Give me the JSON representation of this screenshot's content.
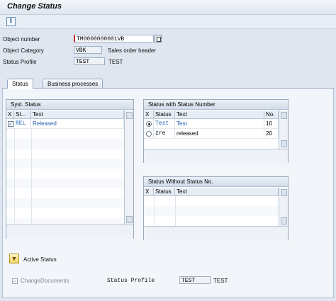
{
  "window": {
    "title": "Change Status"
  },
  "toolbar": {
    "info_icon": "info-icon"
  },
  "header_fields": {
    "object_number": {
      "label": "Object number",
      "value": "TM0000000001VB"
    },
    "object_category": {
      "label": "Object Category",
      "value": "VBK",
      "description": "Sales order header"
    },
    "status_profile": {
      "label": "Status Profile",
      "value": "TEST",
      "description": "TEST"
    }
  },
  "tabs": [
    {
      "label": "Status",
      "active": true
    },
    {
      "label": "Business processes",
      "active": false
    }
  ],
  "syst_status": {
    "title": "Syst. Status",
    "columns": [
      "X",
      "St...",
      "Text"
    ],
    "rows": [
      {
        "checked": true,
        "status": "REL",
        "text": "Released"
      }
    ]
  },
  "status_with_number": {
    "title": "Status with Status Number",
    "columns": [
      "X",
      "Status",
      "Text",
      "No."
    ],
    "rows": [
      {
        "selected": true,
        "status": "Test",
        "text": "Test",
        "no": "10"
      },
      {
        "selected": false,
        "status": "zre",
        "text": "released",
        "no": "20"
      }
    ]
  },
  "status_without_number": {
    "title": "Status Without Status No.",
    "columns": [
      "X",
      "Status",
      "Text"
    ]
  },
  "footer": {
    "active_status_label": "Active Status",
    "change_documents_label": "ChangeDocuments",
    "status_profile_label": "Status Profile",
    "status_profile_value": "TEST",
    "status_profile_text": "TEST"
  },
  "colors": {
    "accent_blue": "#1f63b5",
    "required_marker": "#cc3333"
  }
}
